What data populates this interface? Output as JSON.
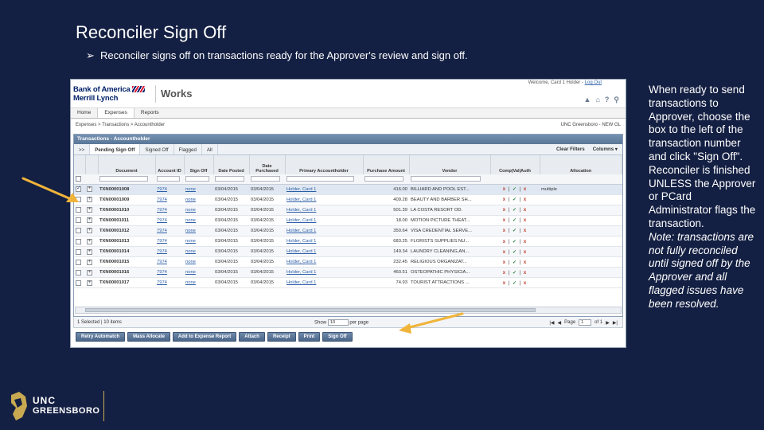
{
  "slide": {
    "title": "Reconciler Sign Off",
    "bullet": "Reconciler signs off on transactions ready for the Approver's review and sign off.",
    "side_text": "When ready to send transactions to Approver, choose the box to the left of the transaction number and click \"Sign Off\". Reconciler is finished UNLESS the Approver or PCard Administrator flags the transaction.",
    "side_note": "Note: transactions are not fully reconciled until signed off by the Approver and all flagged issues have been resolved."
  },
  "app": {
    "brand_line1": "Bank of America",
    "brand_line2": "Merrill Lynch",
    "product": "Works",
    "welcome": "Welcome, Card 1 Holder -",
    "logout": "Log Out",
    "icons": [
      "person-icon",
      "home-icon",
      "help-icon",
      "wrench-icon"
    ],
    "menu": [
      "Home",
      "Expenses",
      "Reports"
    ],
    "breadcrumb": "Expenses  >  Transactions  >  Accountholder",
    "org": "UNC Greensboro - NEW GL",
    "panel_title": "Transactions - Accountholder",
    "tabs": [
      ">>",
      "Pending Sign Off",
      "Signed Off",
      "Flagged",
      "All"
    ],
    "clear_filters": "Clear Filters",
    "columns": "Columns ▾",
    "headers": [
      "Document",
      "Account ID",
      "Sign Off",
      "Date Posted",
      "Date Purchased",
      "Primary Accountholder",
      "Purchase Amount",
      "Vendor",
      "Comp|Val|Auth",
      "Allocation"
    ],
    "rows": [
      {
        "doc": "TXN00001008",
        "acct": "7974",
        "sign": "none",
        "posted": "03/04/2015",
        "purchased": "03/04/2015",
        "holder": "Holder, Card 1",
        "amount": "416.00",
        "vendor": "BILLIARD AND POOL EST...",
        "alloc": "multiple",
        "checked": true
      },
      {
        "doc": "TXN00001009",
        "acct": "7974",
        "sign": "none",
        "posted": "03/04/2015",
        "purchased": "03/04/2015",
        "holder": "Holder, Card 1",
        "amount": "409.28",
        "vendor": "BEAUTY AND BARBER SH...",
        "alloc": "",
        "checked": false
      },
      {
        "doc": "TXN00001010",
        "acct": "7974",
        "sign": "none",
        "posted": "03/04/2015",
        "purchased": "03/04/2015",
        "holder": "Holder, Card 1",
        "amount": "501.39",
        "vendor": "LA COSTA RESORT OD.",
        "alloc": "",
        "checked": false
      },
      {
        "doc": "TXN00001011",
        "acct": "7974",
        "sign": "none",
        "posted": "03/04/2015",
        "purchased": "03/04/2015",
        "holder": "Holder, Card 1",
        "amount": "18.00",
        "vendor": "MOTION PICTURE THEAT...",
        "alloc": "",
        "checked": false
      },
      {
        "doc": "TXN00001012",
        "acct": "7974",
        "sign": "none",
        "posted": "03/04/2015",
        "purchased": "03/04/2015",
        "holder": "Holder, Card 1",
        "amount": "350.64",
        "vendor": "VISA CREDENTIAL SERVE...",
        "alloc": "",
        "checked": false
      },
      {
        "doc": "TXN00001013",
        "acct": "7974",
        "sign": "none",
        "posted": "03/04/2015",
        "purchased": "03/04/2015",
        "holder": "Holder, Card 1",
        "amount": "683.25",
        "vendor": "FLORISTS SUPPLIES NU...",
        "alloc": "",
        "checked": false
      },
      {
        "doc": "TXN00001014",
        "acct": "7974",
        "sign": "none",
        "posted": "03/04/2015",
        "purchased": "03/04/2015",
        "holder": "Holder, Card 1",
        "amount": "149.34",
        "vendor": "LAUNDRY CLEANING,AN...",
        "alloc": "",
        "checked": false
      },
      {
        "doc": "TXN00001015",
        "acct": "7974",
        "sign": "none",
        "posted": "03/04/2015",
        "purchased": "03/04/2015",
        "holder": "Holder, Card 1",
        "amount": "232.45",
        "vendor": "RELIGIOUS ORGANIZAT...",
        "alloc": "",
        "checked": false
      },
      {
        "doc": "TXN00001016",
        "acct": "7974",
        "sign": "none",
        "posted": "03/04/2015",
        "purchased": "03/04/2015",
        "holder": "Holder, Card 1",
        "amount": "460.51",
        "vendor": "OSTEOPATHIC PHYSICIA...",
        "alloc": "",
        "checked": false
      },
      {
        "doc": "TXN00001017",
        "acct": "7974",
        "sign": "none",
        "posted": "03/04/2015",
        "purchased": "03/04/2015",
        "holder": "Holder, Card 1",
        "amount": "74.93",
        "vendor": "TOURIST ATTRACTIONS ...",
        "alloc": "",
        "checked": false
      }
    ],
    "status_marks": [
      "x",
      "✓",
      "x"
    ],
    "pager": {
      "selected": "1 Selected | 10 items",
      "show": "Show",
      "per_page_value": "10",
      "per_page": "per page",
      "page_label": "Page",
      "page_value": "1",
      "of_label": "of 1"
    },
    "actions": [
      "Retry Automatch",
      "Mass Allocate",
      "Add to Expense Report",
      "Attach",
      "Receipt",
      "Print",
      "Sign Off"
    ]
  },
  "logo": {
    "line1": "UNC",
    "line2": "GREENSBORO"
  },
  "colors": {
    "background": "#142043",
    "arrow": "#f0b43a",
    "brand_blue": "#012169",
    "brand_red": "#e31837"
  }
}
